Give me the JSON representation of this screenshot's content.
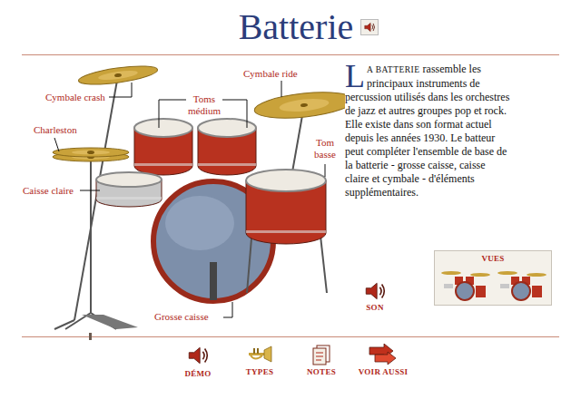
{
  "title": "Batterie",
  "diagram": {
    "labels": [
      "Cymbale crash",
      "Toms médium",
      "Cymbale ride",
      "Charleston",
      "Tom basse",
      "Caisse claire",
      "Grosse caisse"
    ]
  },
  "article": {
    "dropcap": "L",
    "lead": "A BATTERIE",
    "body": " rassemble les principaux instruments de percussion utilisés dans les orchestres de jazz et autres groupes pop et rock. Elle existe dans son format actuel depuis les années 1930. Le batteur peut compléter l'ensemble de base de la batterie - grosse caisse, caisse claire et cymbale - d'éléments supplémentaires."
  },
  "views": {
    "label": "VUES"
  },
  "sound": {
    "label": "SON"
  },
  "nav": [
    "DÉMO",
    "TYPES",
    "NOTES",
    "VOIR AUSSI"
  ]
}
